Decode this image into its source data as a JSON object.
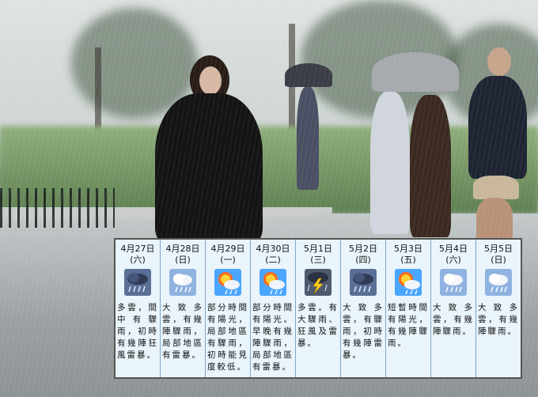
{
  "forecast": {
    "days": [
      {
        "date": "4月27日",
        "dow": "(六)",
        "icon": "rain-thunderstorm-icon",
        "desc": "多雲，間中有驟雨，初時有幾陣狂風雷暴。"
      },
      {
        "date": "4月28日",
        "dow": "(日)",
        "icon": "showers-icon",
        "desc": "大致多雲，有幾陣驟雨，局部地區有雷暴。"
      },
      {
        "date": "4月29日",
        "dow": "(一)",
        "icon": "sunny-periods-showers-icon",
        "desc": "部分時間有陽光，局部地區有驟雨，初時能見度較低。"
      },
      {
        "date": "4月30日",
        "dow": "(二)",
        "icon": "sunny-periods-showers-icon",
        "desc": "部分時間有陽光。早晚有幾陣驟雨，局部地區有雷暴。"
      },
      {
        "date": "5月1日",
        "dow": "(三)",
        "icon": "thunderstorm-icon",
        "desc": "多雲。有大驟雨、狂風及雷暴。"
      },
      {
        "date": "5月2日",
        "dow": "(四)",
        "icon": "rain-thunderstorm-icon",
        "desc": "大致多雲，有驟雨，初時有幾陣雷暴。"
      },
      {
        "date": "5月3日",
        "dow": "(五)",
        "icon": "sunny-periods-showers-icon",
        "desc": "短暫時間有陽光，有幾陣驟雨。"
      },
      {
        "date": "5月4日",
        "dow": "(六)",
        "icon": "showers-icon",
        "desc": "大致多雲，有幾陣驟雨。"
      },
      {
        "date": "5月5日",
        "dow": "(日)",
        "icon": "showers-icon",
        "desc": "大致多雲，有幾陣驟雨。"
      }
    ]
  },
  "colors": {
    "panel_bg": "#eaf4fb",
    "divider": "#7da6c8",
    "border": "#555555"
  }
}
